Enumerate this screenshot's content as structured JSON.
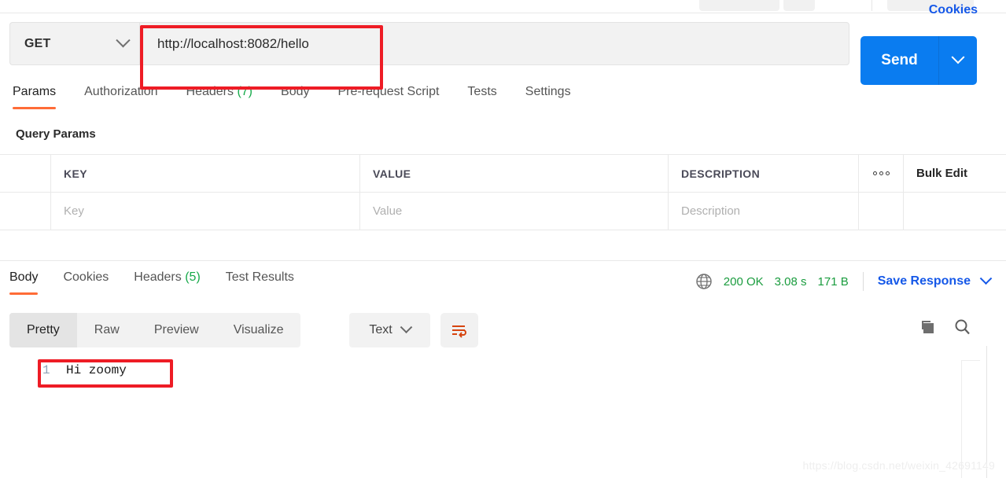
{
  "request": {
    "method": "GET",
    "url": "http://localhost:8082/hello",
    "send_label": "Send",
    "tabs": [
      {
        "label": "Params",
        "count": "",
        "active": true
      },
      {
        "label": "Authorization",
        "count": "",
        "active": false
      },
      {
        "label": "Headers",
        "count": "(7)",
        "active": false
      },
      {
        "label": "Body",
        "count": "",
        "active": false
      },
      {
        "label": "Pre-request Script",
        "count": "",
        "active": false
      },
      {
        "label": "Tests",
        "count": "",
        "active": false
      },
      {
        "label": "Settings",
        "count": "",
        "active": false
      }
    ],
    "cookies_label": "Cookies"
  },
  "query_params": {
    "title": "Query Params",
    "headers": {
      "key": "KEY",
      "value": "VALUE",
      "description": "DESCRIPTION",
      "bulk_edit": "Bulk Edit"
    },
    "rows": [
      {
        "key_placeholder": "Key",
        "value_placeholder": "Value",
        "description_placeholder": "Description"
      }
    ]
  },
  "response": {
    "tabs": [
      {
        "label": "Body",
        "count": "",
        "active": true
      },
      {
        "label": "Cookies",
        "count": "",
        "active": false
      },
      {
        "label": "Headers",
        "count": "(5)",
        "active": false
      },
      {
        "label": "Test Results",
        "count": "",
        "active": false
      }
    ],
    "status": {
      "code": "200 OK",
      "time": "3.08 s",
      "size": "171 B",
      "save_label": "Save Response"
    },
    "view_modes": [
      {
        "label": "Pretty",
        "active": true
      },
      {
        "label": "Raw",
        "active": false
      },
      {
        "label": "Preview",
        "active": false
      },
      {
        "label": "Visualize",
        "active": false
      }
    ],
    "format": "Text",
    "body": {
      "line_number": "1",
      "text": "Hi zoomy"
    }
  },
  "watermark": "https://blog.csdn.net/weixin_42691149",
  "colors": {
    "accent_orange": "#ff6c37",
    "link_blue": "#1558e8",
    "send_blue": "#0a7cf0",
    "status_green": "#1a9c3e",
    "annotation_red": "#ee1c25"
  }
}
